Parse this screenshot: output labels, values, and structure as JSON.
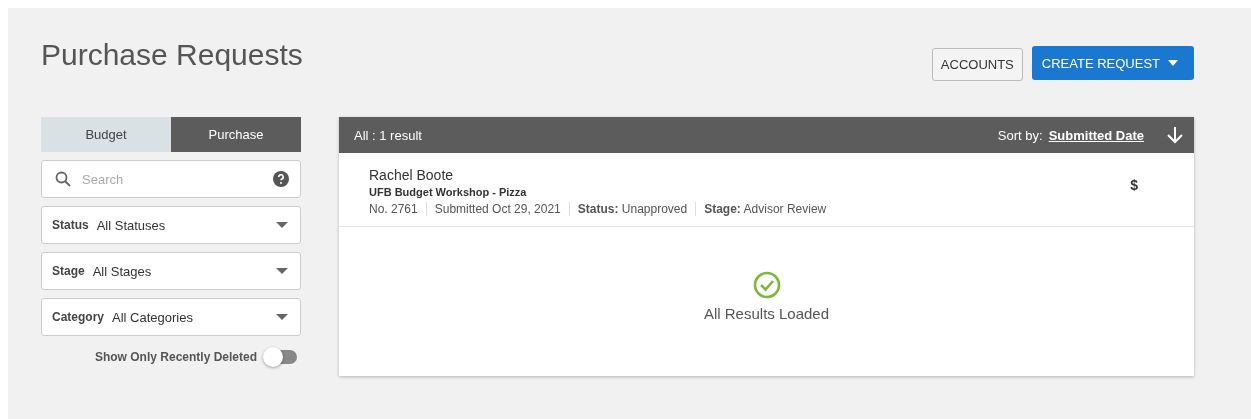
{
  "page": {
    "title": "Purchase Requests"
  },
  "header_buttons": [
    {
      "label": "ACCOUNTS",
      "kind": "plain"
    },
    {
      "label": "CREATE REQUEST",
      "kind": "primary"
    }
  ],
  "tabs": [
    {
      "label": "Budget",
      "selected": false
    },
    {
      "label": "Purchase",
      "selected": true
    }
  ],
  "search": {
    "placeholder": "Search"
  },
  "filters": [
    {
      "label": "Status",
      "value": "All Statuses"
    },
    {
      "label": "Stage",
      "value": "All Stages"
    },
    {
      "label": "Category",
      "value": "All Categories"
    }
  ],
  "recently_deleted": {
    "label": "Show Only Recently Deleted",
    "on": false
  },
  "results": {
    "summary": "All : 1 result",
    "sort_label": "Sort by:",
    "sort_value": "Submitted Date",
    "items": [
      {
        "requester": "Rachel Boote",
        "title": "UFB Budget Workshop - Pizza",
        "amount": "$",
        "meta": [
          "No. 2761",
          "Submitted Oct 29, 2021",
          "**Status:** Unapproved",
          "**Stage:** Advisor Review"
        ]
      }
    ],
    "footer": "All Results Loaded"
  }
}
